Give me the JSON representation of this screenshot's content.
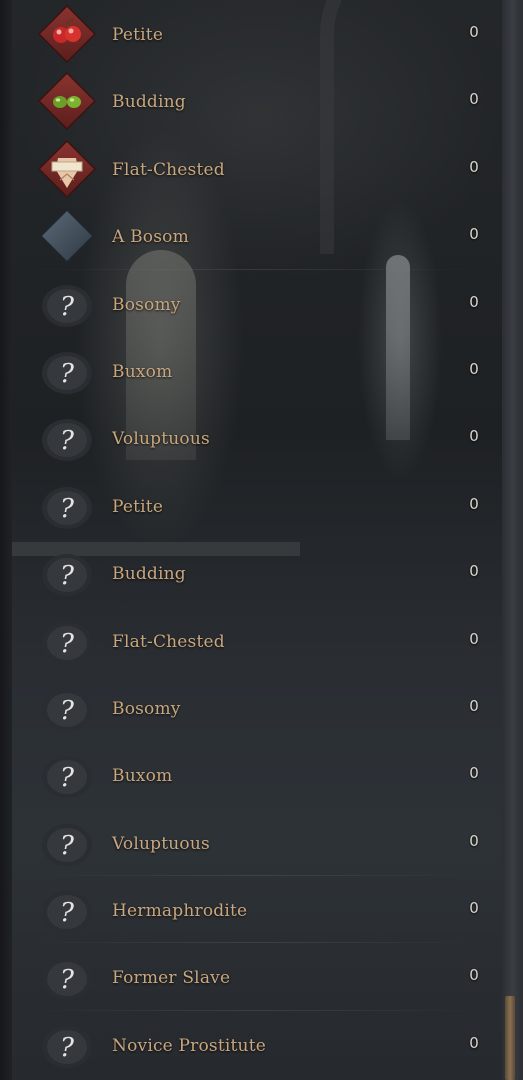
{
  "traits": [
    {
      "label": "Petite",
      "count": "0",
      "icon": "apples-icon"
    },
    {
      "label": "Budding",
      "count": "0",
      "icon": "green-buds-icon"
    },
    {
      "label": "Flat-Chested",
      "count": "0",
      "icon": "flat-chest-icon"
    },
    {
      "label": "A Bosom",
      "count": "0",
      "icon": "blank-diamond-icon"
    },
    {
      "label": "Bosomy",
      "count": "0",
      "icon": "unknown-icon"
    },
    {
      "label": "Buxom",
      "count": "0",
      "icon": "unknown-icon"
    },
    {
      "label": "Voluptuous",
      "count": "0",
      "icon": "unknown-icon"
    },
    {
      "label": "Petite",
      "count": "0",
      "icon": "unknown-icon"
    },
    {
      "label": "Budding",
      "count": "0",
      "icon": "unknown-icon"
    },
    {
      "label": "Flat-Chested",
      "count": "0",
      "icon": "unknown-icon"
    },
    {
      "label": "Bosomy",
      "count": "0",
      "icon": "unknown-icon"
    },
    {
      "label": "Buxom",
      "count": "0",
      "icon": "unknown-icon"
    },
    {
      "label": "Voluptuous",
      "count": "0",
      "icon": "unknown-icon"
    },
    {
      "label": "Hermaphrodite",
      "count": "0",
      "icon": "unknown-icon"
    },
    {
      "label": "Former Slave",
      "count": "0",
      "icon": "unknown-icon"
    },
    {
      "label": "Novice Prostitute",
      "count": "0",
      "icon": "unknown-icon"
    }
  ],
  "colors": {
    "label": "#c9a77e",
    "count": "#d8d4cc",
    "diamond_red": "#7a2a26",
    "diamond_slate": "#4a5866",
    "scroll_thumb": "#8a7050"
  }
}
